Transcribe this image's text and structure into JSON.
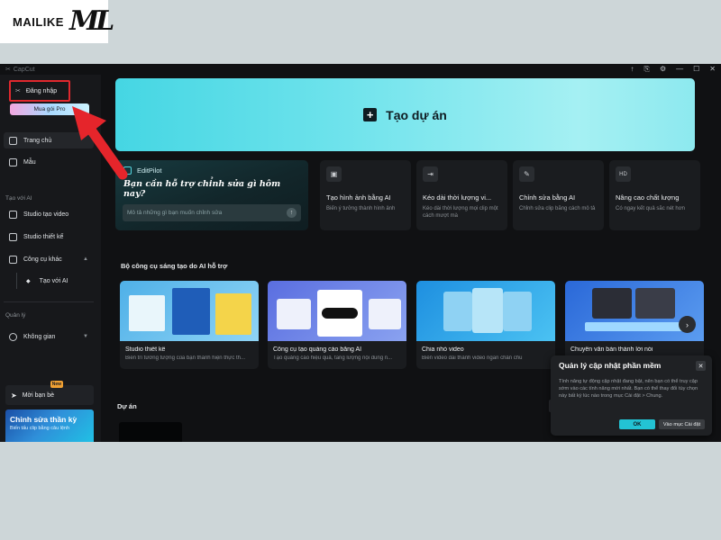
{
  "watermark": {
    "text": "MAILIKE",
    "mark": "ML"
  },
  "window": {
    "app_name": "CapCut",
    "controls": [
      "↑",
      "⎘",
      "⚙",
      "—",
      "☐",
      "✕"
    ]
  },
  "sidebar": {
    "login_label": "Đăng nhập",
    "pro_label": "Mua gói Pro",
    "nav": [
      {
        "label": "Trang chủ",
        "icon": "home-icon"
      },
      {
        "label": "Mẫu",
        "icon": "template-icon"
      }
    ],
    "ai_section": "Tạo với AI",
    "ai_items": [
      {
        "label": "Studio tạo video",
        "icon": "video-studio-icon"
      },
      {
        "label": "Studio thiết kế",
        "icon": "design-studio-icon"
      },
      {
        "label": "Công cụ khác",
        "icon": "tools-icon"
      }
    ],
    "sub_item": "Tạo với AI",
    "manage_section": "Quản lý",
    "space_label": "Không gian",
    "invite_label": "Mời bạn bè",
    "new_badge": "New",
    "promo_title": "Chỉnh sửa thần kỳ",
    "promo_sub": "Biến tấu clip bằng câu lệnh"
  },
  "hero": {
    "plus": "+",
    "title": "Tạo dự án"
  },
  "editpilot": {
    "name": "EditPilot",
    "question": "Bạn cần hỗ trợ chỉnh sửa gì hôm nay?",
    "placeholder": "Mô tả những gì bạn muốn chỉnh sửa"
  },
  "tools": [
    {
      "title": "Tạo hình ảnh bằng AI",
      "desc": "Biến ý tưởng thành hình ảnh",
      "glyph": "▣"
    },
    {
      "title": "Kéo dài thời lượng vi...",
      "desc": "Kéo dài thời lượng mọi clip một cách mượt mà",
      "glyph": "⇥"
    },
    {
      "title": "Chỉnh sửa bằng AI",
      "desc": "Chỉnh sửa clip bằng cách mô tả",
      "glyph": "✎"
    },
    {
      "title": "Nâng cao chất lượng",
      "desc": "Có ngay kết quả sắc nét hơn",
      "glyph": "HD"
    }
  ],
  "features_title": "Bộ công cụ sáng tạo do AI hỗ trợ",
  "features": [
    {
      "title": "Studio thiết kế",
      "desc": "Biến trí tưởng tượng của bạn thành hiện thực th..."
    },
    {
      "title": "Công cụ tạo quảng cáo bằng AI",
      "desc": "Tạo quảng cáo hiệu quả, tăng lượng nội dung n..."
    },
    {
      "title": "Chia nhỏ video",
      "desc": "Biến video dài thành video ngắn chân chu"
    },
    {
      "title": "Chuyển văn bản thành lời nói",
      "desc": ""
    }
  ],
  "next_arrow": "›",
  "projects_title": "Dự án",
  "dialog": {
    "title": "Quản lý cập nhật phần mềm",
    "close": "✕",
    "body": "Tính năng tự động cập nhật đang bật, nên bạn có thể truy cập sớm vào các tính năng mới nhất. Bạn có thể thay đổi tùy chọn này bất kỳ lúc nào trong mục Cài đặt > Chung.",
    "ok": "OK",
    "settings": "Vào mục Cài đặt"
  },
  "colors": {
    "accent": "#23c3d4",
    "highlight": "#e0282e"
  }
}
